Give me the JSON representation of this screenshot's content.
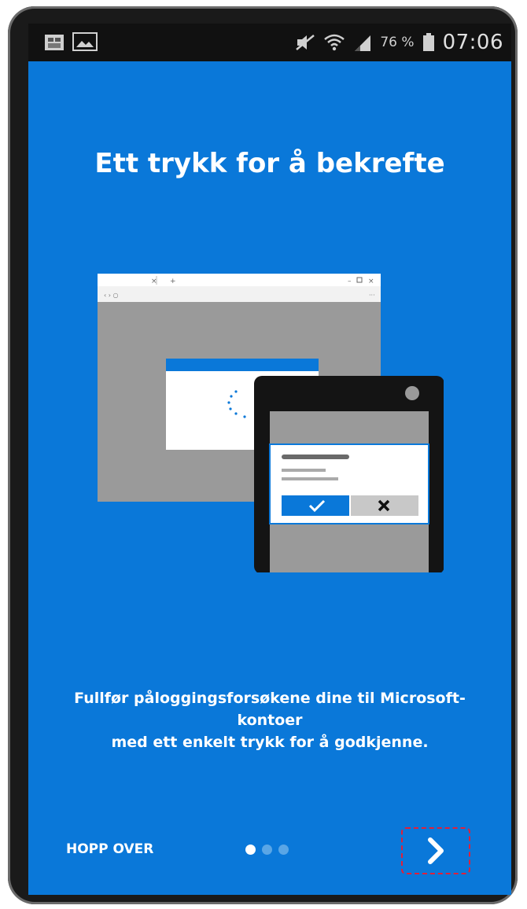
{
  "status_bar": {
    "battery_percent": "76 %",
    "time": "07:06"
  },
  "onboarding": {
    "title": "Ett trykk for å bekrefte",
    "description_line1": "Fullfør påloggingsforsøkene dine til Microsoft-kontoer",
    "description_line2": "med ett enkelt trykk for å godkjenne.",
    "skip_label": "HOPP OVER",
    "page_indicator": {
      "total": 3,
      "current": 1
    },
    "next_icon": "chevron-right-icon"
  },
  "colors": {
    "background": "#0a78d9",
    "approve": "#0a78d9",
    "deny": "#c8c8c8"
  }
}
